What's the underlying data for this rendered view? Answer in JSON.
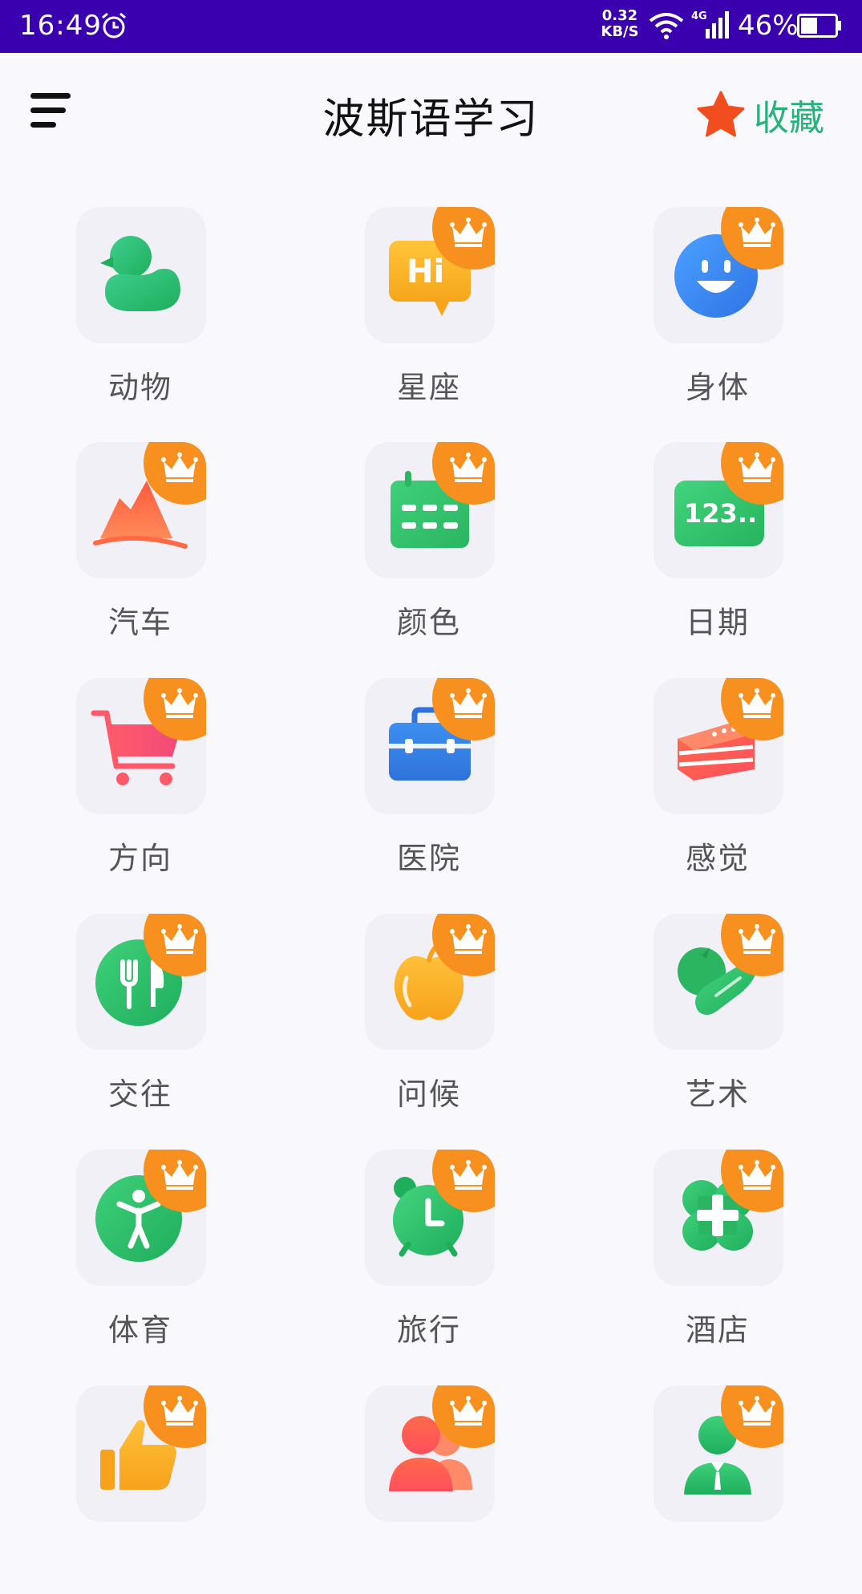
{
  "status_bar": {
    "time": "16:49",
    "speed_value": "0.32",
    "speed_unit": "KB/S",
    "network": "4G",
    "battery": "46%"
  },
  "header": {
    "title": "波斯语学习",
    "favorites_label": "收藏",
    "accent_color": "#27b27a",
    "star_color": "#f24d1f"
  },
  "categories": [
    {
      "label": "动物",
      "icon": "duck-icon",
      "locked": false
    },
    {
      "label": "星座",
      "icon": "hi-bubble-icon",
      "locked": true
    },
    {
      "label": "身体",
      "icon": "smiley-icon",
      "locked": true
    },
    {
      "label": "汽车",
      "icon": "mountain-icon",
      "locked": true
    },
    {
      "label": "颜色",
      "icon": "calendar-icon",
      "locked": true
    },
    {
      "label": "日期",
      "icon": "numbers-icon",
      "locked": true
    },
    {
      "label": "方向",
      "icon": "cart-icon",
      "locked": true
    },
    {
      "label": "医院",
      "icon": "briefcase-icon",
      "locked": true
    },
    {
      "label": "感觉",
      "icon": "cake-icon",
      "locked": true
    },
    {
      "label": "交往",
      "icon": "restaurant-icon",
      "locked": true
    },
    {
      "label": "问候",
      "icon": "apple-icon",
      "locked": true
    },
    {
      "label": "艺术",
      "icon": "vegetables-icon",
      "locked": true
    },
    {
      "label": "体育",
      "icon": "person-icon",
      "locked": true
    },
    {
      "label": "旅行",
      "icon": "alarm-clock-icon",
      "locked": true
    },
    {
      "label": "酒店",
      "icon": "medical-cross-icon",
      "locked": true
    },
    {
      "label": "",
      "icon": "thumbs-up-icon",
      "locked": true
    },
    {
      "label": "",
      "icon": "people-icon",
      "locked": true
    },
    {
      "label": "",
      "icon": "businessman-icon",
      "locked": true
    }
  ]
}
